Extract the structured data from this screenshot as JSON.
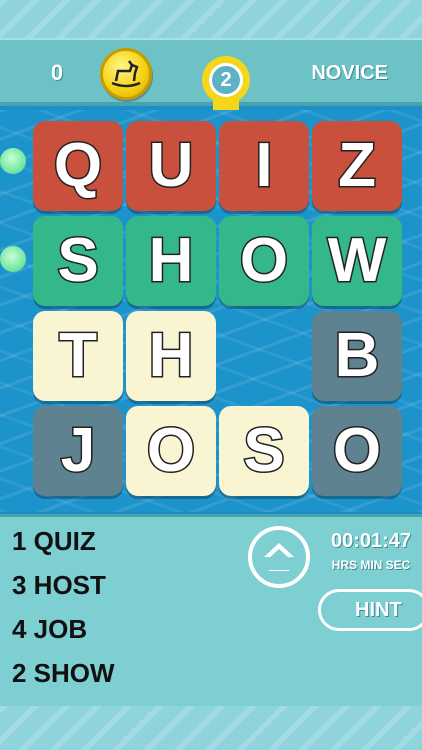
{
  "header": {
    "coins": "0",
    "level_badge": "2",
    "difficulty": "NOVICE"
  },
  "board": {
    "rows": [
      [
        {
          "letter": "Q",
          "color": "red"
        },
        {
          "letter": "U",
          "color": "red"
        },
        {
          "letter": "I",
          "color": "red"
        },
        {
          "letter": "Z",
          "color": "red"
        }
      ],
      [
        {
          "letter": "S",
          "color": "green"
        },
        {
          "letter": "H",
          "color": "green"
        },
        {
          "letter": "O",
          "color": "green"
        },
        {
          "letter": "W",
          "color": "green"
        }
      ],
      [
        {
          "letter": "T",
          "color": "cream"
        },
        {
          "letter": "H",
          "color": "cream"
        },
        null,
        {
          "letter": "B",
          "color": "slate"
        }
      ],
      [
        {
          "letter": "J",
          "color": "slate"
        },
        {
          "letter": "O",
          "color": "cream"
        },
        {
          "letter": "S",
          "color": "cream"
        },
        {
          "letter": "O",
          "color": "slate"
        }
      ]
    ]
  },
  "words": [
    "1 QUIZ",
    "3 HOST",
    "4 JOB",
    "2 SHOW"
  ],
  "timer": {
    "value": "00:01:47",
    "units": "HRS MIN SEC"
  },
  "hint_label": "HINT",
  "colors": {
    "red": "#c9503c",
    "green": "#34b889",
    "cream": "#f9f5d2",
    "slate": "#5f8290",
    "background": "#1a8fc9",
    "panel": "#7dcfd2"
  }
}
